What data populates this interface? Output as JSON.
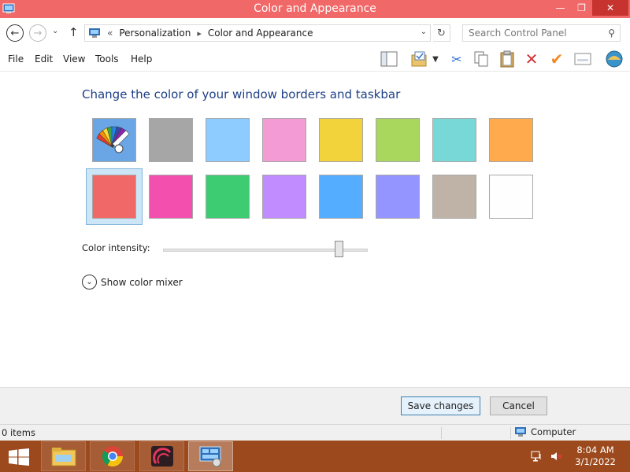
{
  "window": {
    "title": "Color and Appearance",
    "minimize_glyph": "—",
    "maximize_glyph": "❐",
    "close_glyph": "✕",
    "accent_color": "#f06868"
  },
  "address_bar": {
    "back_glyph": "←",
    "forward_glyph": "→",
    "up_glyph": "↑",
    "overflow_glyph": "«",
    "breadcrumbs": [
      "Personalization",
      "Color and Appearance"
    ],
    "separator_glyph": "▸",
    "dropdown_glyph": "⌄",
    "refresh_glyph": "↻",
    "search_placeholder": "Search Control Panel"
  },
  "menu": {
    "items": [
      "File",
      "Edit",
      "View",
      "Tools",
      "Help"
    ]
  },
  "toolbar": {
    "icons": [
      "layout-icon",
      "folder-properties-icon",
      "dropdown-icon",
      "cut-icon",
      "copy-icon",
      "paste-icon",
      "delete-icon",
      "check-icon",
      "window-icon",
      "shell-icon"
    ]
  },
  "main": {
    "heading": "Change the color of your window borders and taskbar",
    "swatches": [
      {
        "name": "automatic",
        "color": "#ffffff",
        "icon": "color-palette-icon"
      },
      {
        "name": "gray",
        "color": "#a6a6a6"
      },
      {
        "name": "sky-blue",
        "color": "#8ecbff"
      },
      {
        "name": "pink",
        "color": "#f29bd4"
      },
      {
        "name": "yellow",
        "color": "#f2d33c"
      },
      {
        "name": "lime",
        "color": "#a9d65c"
      },
      {
        "name": "teal",
        "color": "#78d8d8"
      },
      {
        "name": "orange",
        "color": "#ffab4d"
      },
      {
        "name": "red",
        "color": "#f06868",
        "selected": true
      },
      {
        "name": "magenta",
        "color": "#f34fae"
      },
      {
        "name": "green",
        "color": "#3dcc72"
      },
      {
        "name": "violet",
        "color": "#c08cff"
      },
      {
        "name": "blue",
        "color": "#55adff"
      },
      {
        "name": "lavender",
        "color": "#9595ff"
      },
      {
        "name": "taupe",
        "color": "#bfb3a8"
      },
      {
        "name": "white",
        "color": "#fefefe"
      }
    ],
    "intensity_label": "Color intensity:",
    "intensity_value": 0.86,
    "mixer_glyph": "⌄",
    "mixer_label": "Show color mixer"
  },
  "buttons": {
    "save": "Save changes",
    "cancel": "Cancel"
  },
  "status": {
    "items": "0 items",
    "location": "Computer"
  },
  "taskbar": {
    "apps": [
      "file-explorer-icon",
      "chrome-icon",
      "app-icon",
      "control-panel-icon"
    ],
    "time": "8:04 AM",
    "date": "3/1/2022",
    "tray_icons": [
      "network-icon",
      "volume-muted-icon"
    ],
    "color": "#9c4a1d"
  }
}
